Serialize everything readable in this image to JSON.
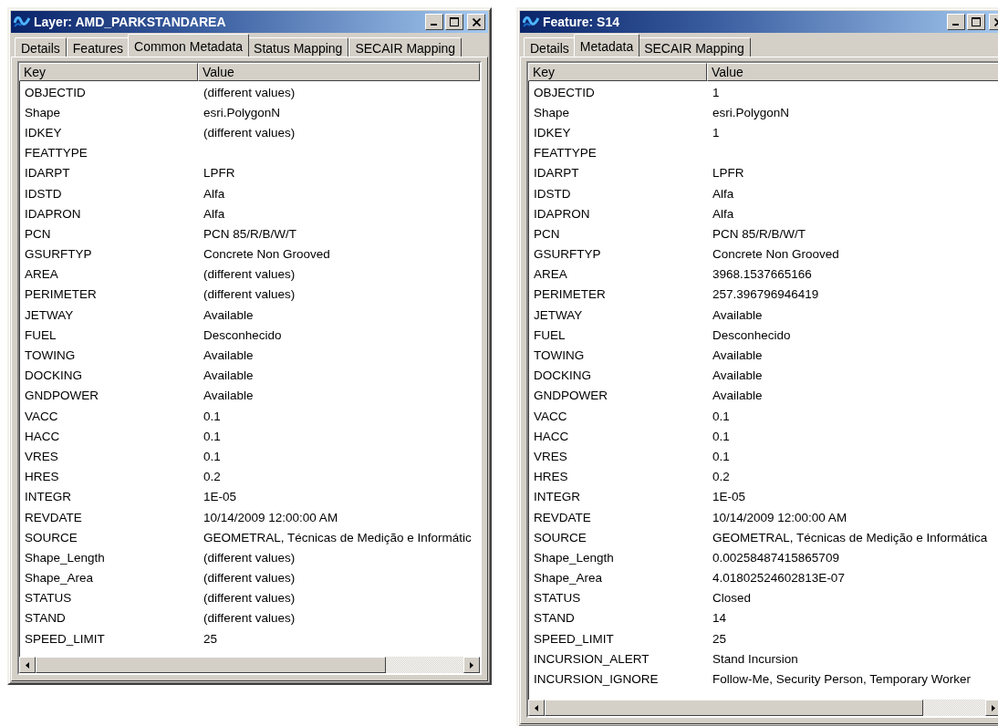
{
  "windows": [
    {
      "title": "Layer: AMD_PARKSTANDAREA",
      "tabs": [
        {
          "label": "Details",
          "selected": false
        },
        {
          "label": "Features",
          "selected": false
        },
        {
          "label": "Common Metadata",
          "selected": true
        },
        {
          "label": "Status Mapping",
          "selected": false
        },
        {
          "label": "SECAIR Mapping",
          "selected": false
        }
      ],
      "columns": [
        "Key",
        "Value"
      ],
      "rows": [
        {
          "key": "OBJECTID",
          "value": "(different values)"
        },
        {
          "key": "Shape",
          "value": "esri.PolygonN"
        },
        {
          "key": "IDKEY",
          "value": "(different values)"
        },
        {
          "key": "FEATTYPE"
        },
        {
          "key": "IDARPT",
          "value": "LPFR"
        },
        {
          "key": "IDSTD",
          "value": "Alfa"
        },
        {
          "key": "IDAPRON",
          "value": "Alfa"
        },
        {
          "key": "PCN",
          "value": "PCN 85/R/B/W/T"
        },
        {
          "key": "GSURFTYP",
          "value": "Concrete Non Grooved"
        },
        {
          "key": "AREA",
          "value": "(different values)"
        },
        {
          "key": "PERIMETER",
          "value": "(different values)"
        },
        {
          "key": "JETWAY",
          "value": "Available"
        },
        {
          "key": "FUEL",
          "value": "Desconhecido"
        },
        {
          "key": "TOWING",
          "value": "Available"
        },
        {
          "key": "DOCKING",
          "value": "Available"
        },
        {
          "key": "GNDPOWER",
          "value": "Available"
        },
        {
          "key": "VACC",
          "value": "0.1"
        },
        {
          "key": "HACC",
          "value": "0.1"
        },
        {
          "key": "VRES",
          "value": "0.1"
        },
        {
          "key": "HRES",
          "value": "0.2"
        },
        {
          "key": "INTEGR",
          "value": "1E-05"
        },
        {
          "key": "REVDATE",
          "value": "10/14/2009 12:00:00 AM"
        },
        {
          "key": "SOURCE",
          "value": "GEOMETRAL, Técnicas de Medição e Informátic"
        },
        {
          "key": "Shape_Length",
          "value": "(different values)"
        },
        {
          "key": "Shape_Area",
          "value": "(different values)"
        },
        {
          "key": "STATUS",
          "value": "(different values)"
        },
        {
          "key": "STAND",
          "value": "(different values)"
        },
        {
          "key": "SPEED_LIMIT",
          "value": "25"
        }
      ]
    },
    {
      "title": "Feature: S14",
      "tabs": [
        {
          "label": "Details",
          "selected": false
        },
        {
          "label": "Metadata",
          "selected": true
        },
        {
          "label": "SECAIR Mapping",
          "selected": false
        }
      ],
      "columns": [
        "Key",
        "Value"
      ],
      "rows": [
        {
          "key": "OBJECTID",
          "value": "1"
        },
        {
          "key": "Shape",
          "value": "esri.PolygonN"
        },
        {
          "key": "IDKEY",
          "value": "1"
        },
        {
          "key": "FEATTYPE"
        },
        {
          "key": "IDARPT",
          "value": "LPFR"
        },
        {
          "key": "IDSTD",
          "value": "Alfa"
        },
        {
          "key": "IDAPRON",
          "value": "Alfa"
        },
        {
          "key": "PCN",
          "value": "PCN 85/R/B/W/T"
        },
        {
          "key": "GSURFTYP",
          "value": "Concrete Non Grooved"
        },
        {
          "key": "AREA",
          "value": "3968.1537665166"
        },
        {
          "key": "PERIMETER",
          "value": "257.396796946419"
        },
        {
          "key": "JETWAY",
          "value": "Available"
        },
        {
          "key": "FUEL",
          "value": "Desconhecido"
        },
        {
          "key": "TOWING",
          "value": "Available"
        },
        {
          "key": "DOCKING",
          "value": "Available"
        },
        {
          "key": "GNDPOWER",
          "value": "Available"
        },
        {
          "key": "VACC",
          "value": "0.1"
        },
        {
          "key": "HACC",
          "value": "0.1"
        },
        {
          "key": "VRES",
          "value": "0.1"
        },
        {
          "key": "HRES",
          "value": "0.2"
        },
        {
          "key": "INTEGR",
          "value": "1E-05"
        },
        {
          "key": "REVDATE",
          "value": "10/14/2009 12:00:00 AM"
        },
        {
          "key": "SOURCE",
          "value": "GEOMETRAL, Técnicas de Medição e Informática"
        },
        {
          "key": "Shape_Length",
          "value": "0.00258487415865709"
        },
        {
          "key": "Shape_Area",
          "value": "4.01802524602813E-07"
        },
        {
          "key": "STATUS",
          "value": "Closed"
        },
        {
          "key": "STAND",
          "value": "14"
        },
        {
          "key": "SPEED_LIMIT",
          "value": "25"
        },
        {
          "key": "INCURSION_ALERT",
          "value": "Stand Incursion"
        },
        {
          "key": "INCURSION_IGNORE",
          "value": "Follow-Me, Security Person, Temporary Worker"
        }
      ]
    }
  ]
}
